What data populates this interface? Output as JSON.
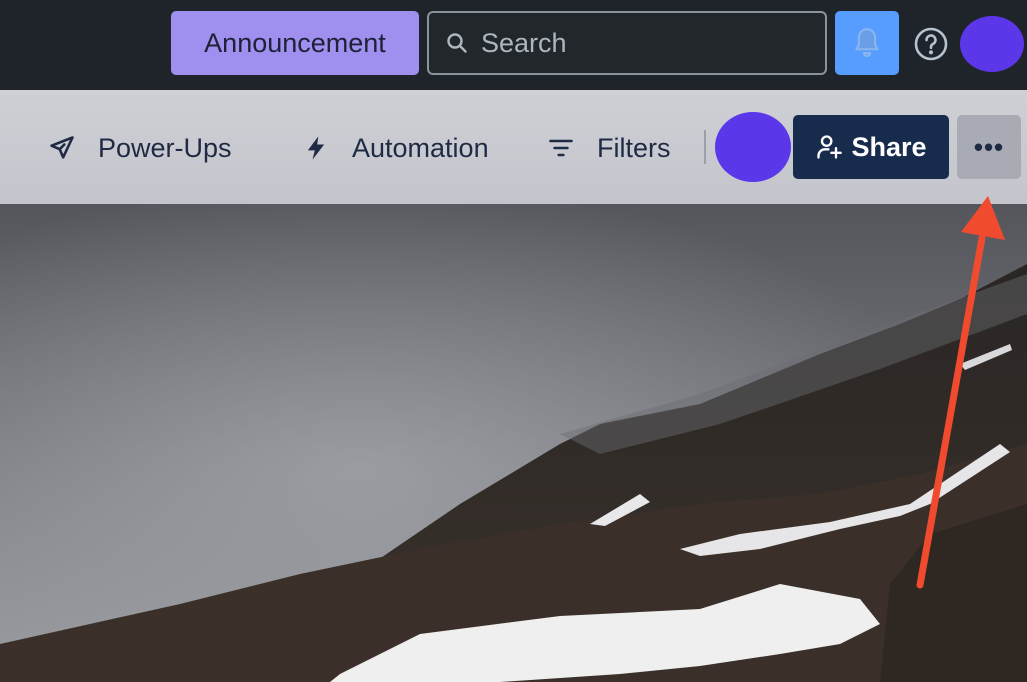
{
  "topbar": {
    "announcement_label": "Announcement",
    "search_placeholder": "Search",
    "icons": {
      "search": "search-icon",
      "notifications": "bell-icon",
      "help": "help-icon"
    },
    "colors": {
      "background": "#1f232a",
      "announcement": "#9f8fef",
      "notify": "#579dff",
      "avatar": "#5a37e8"
    }
  },
  "board_header": {
    "powerups_label": "Power-Ups",
    "automation_label": "Automation",
    "filters_label": "Filters",
    "share_label": "Share",
    "more_label": "•••",
    "icons": {
      "powerups": "rocket-icon",
      "automation": "lightning-icon",
      "filters": "filter-icon",
      "share": "add-user-icon",
      "more": "ellipsis-icon"
    },
    "colors": {
      "share": "#172b4d",
      "more": "#a8abb3"
    }
  },
  "annotation": {
    "type": "arrow",
    "color": "#f04a2f",
    "points_to": "more-button"
  }
}
